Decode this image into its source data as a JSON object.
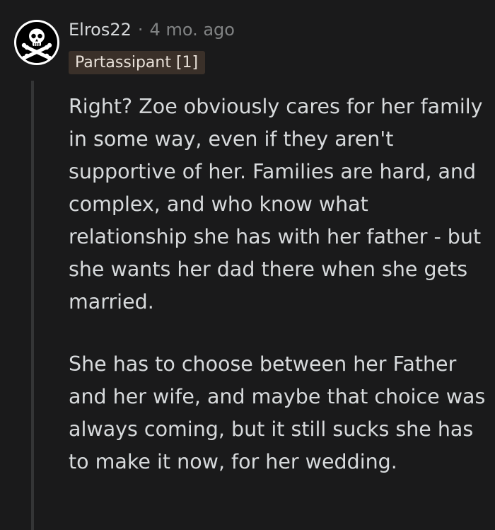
{
  "comment": {
    "author": "Elros22",
    "separator": "·",
    "timestamp": "4 mo. ago",
    "flair": "Partassipant [1]",
    "paragraphs": [
      "Right? Zoe obviously cares for her family in some way, even if they aren't supportive of her. Families are hard, and complex, and who know what relationship she has with her father - but she wants her dad there when she gets married.",
      "She has to choose between her Father and her wife, and maybe that choice was always coming, but it still sucks she has to make it now, for her wedding."
    ],
    "avatar_icon": "skull-crossbones-icon"
  },
  "colors": {
    "background": "#1a1a1b",
    "text": "#d7dadc",
    "meta": "#818384",
    "flair_bg": "#3a3029",
    "thread_line": "#343536"
  }
}
